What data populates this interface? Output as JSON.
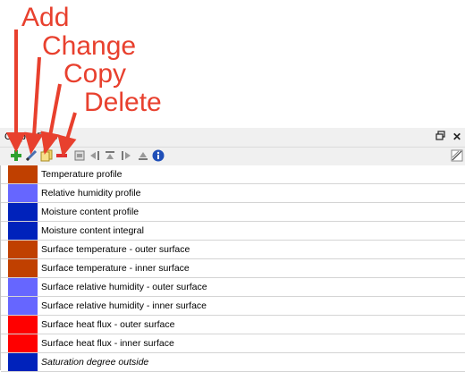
{
  "annotations": {
    "add": "Add",
    "change": "Change",
    "copy": "Copy",
    "delete": "Delete",
    "arrow_color": "#e8402e"
  },
  "panel": {
    "title": "Output Files",
    "float_icon": "restore-icon",
    "close_icon": "close-icon"
  },
  "toolbar": {
    "tools": [
      {
        "name": "add-icon"
      },
      {
        "name": "edit-icon"
      },
      {
        "name": "copy-icon"
      },
      {
        "name": "delete-icon"
      },
      {
        "name": "properties-icon"
      },
      {
        "name": "move-right-icon"
      },
      {
        "name": "move-top-icon"
      },
      {
        "name": "move-left-icon"
      },
      {
        "name": "move-bottom-icon"
      },
      {
        "name": "info-icon"
      },
      {
        "name": "chart-toggle-icon"
      }
    ]
  },
  "rows": [
    {
      "label": "Temperature profile",
      "color": "#c04000",
      "italic": false
    },
    {
      "label": "Relative humidity profile",
      "color": "#6666ff",
      "italic": false
    },
    {
      "label": "Moisture content profile",
      "color": "#0022bb",
      "italic": false
    },
    {
      "label": "Moisture content integral",
      "color": "#0022bb",
      "italic": false
    },
    {
      "label": "Surface temperature - outer surface",
      "color": "#c04000",
      "italic": false
    },
    {
      "label": "Surface temperature - inner surface",
      "color": "#c04000",
      "italic": false
    },
    {
      "label": "Surface relative humidity - outer surface",
      "color": "#6666ff",
      "italic": false
    },
    {
      "label": "Surface relative humidity - inner surface",
      "color": "#6666ff",
      "italic": false
    },
    {
      "label": "Surface heat flux - outer surface",
      "color": "#ff0000",
      "italic": false
    },
    {
      "label": "Surface heat flux - inner surface",
      "color": "#ff0000",
      "italic": false
    },
    {
      "label": "Saturation degree outside",
      "color": "#0022bb",
      "italic": true
    }
  ]
}
